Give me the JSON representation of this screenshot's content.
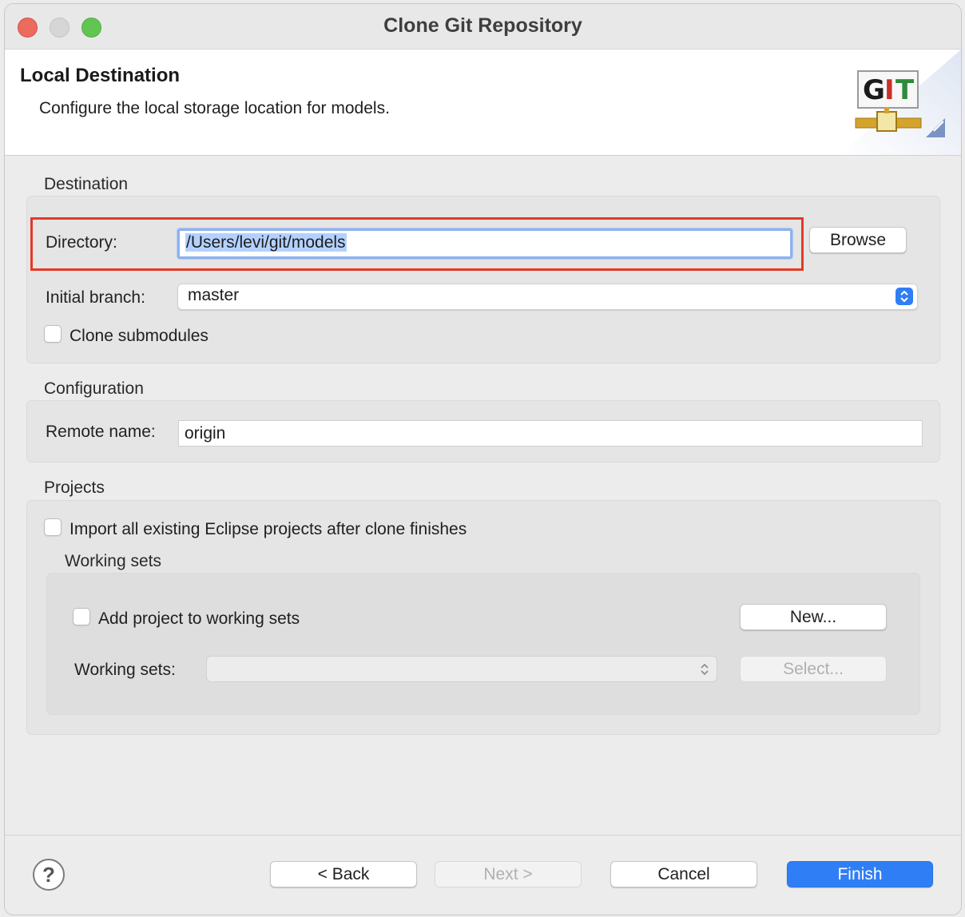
{
  "window": {
    "title": "Clone Git Repository"
  },
  "header": {
    "title": "Local Destination",
    "description": "Configure the local storage location for models.",
    "logo_icon": "git-logo-icon",
    "logo_text": "GIT"
  },
  "destination": {
    "section_label": "Destination",
    "directory_label": "Directory:",
    "directory_value": "/Users/levi/git/models",
    "browse_label": "Browse",
    "branch_label": "Initial branch:",
    "branch_value": "master",
    "clone_submodules_label": "Clone submodules",
    "clone_submodules_checked": false
  },
  "configuration": {
    "section_label": "Configuration",
    "remote_label": "Remote name:",
    "remote_value": "origin"
  },
  "projects": {
    "section_label": "Projects",
    "import_label": "Import all existing Eclipse projects after clone finishes",
    "import_checked": false,
    "working_sets_label": "Working sets",
    "add_to_sets_label": "Add project to working sets",
    "add_to_sets_checked": false,
    "new_label": "New...",
    "sets_field_label": "Working sets:",
    "sets_value": "",
    "select_label": "Select..."
  },
  "footer": {
    "back_label": "< Back",
    "next_label": "Next >",
    "cancel_label": "Cancel",
    "finish_label": "Finish",
    "help_symbol": "?"
  },
  "colors": {
    "accent": "#2f7ef6",
    "highlight": "#e23a26"
  }
}
